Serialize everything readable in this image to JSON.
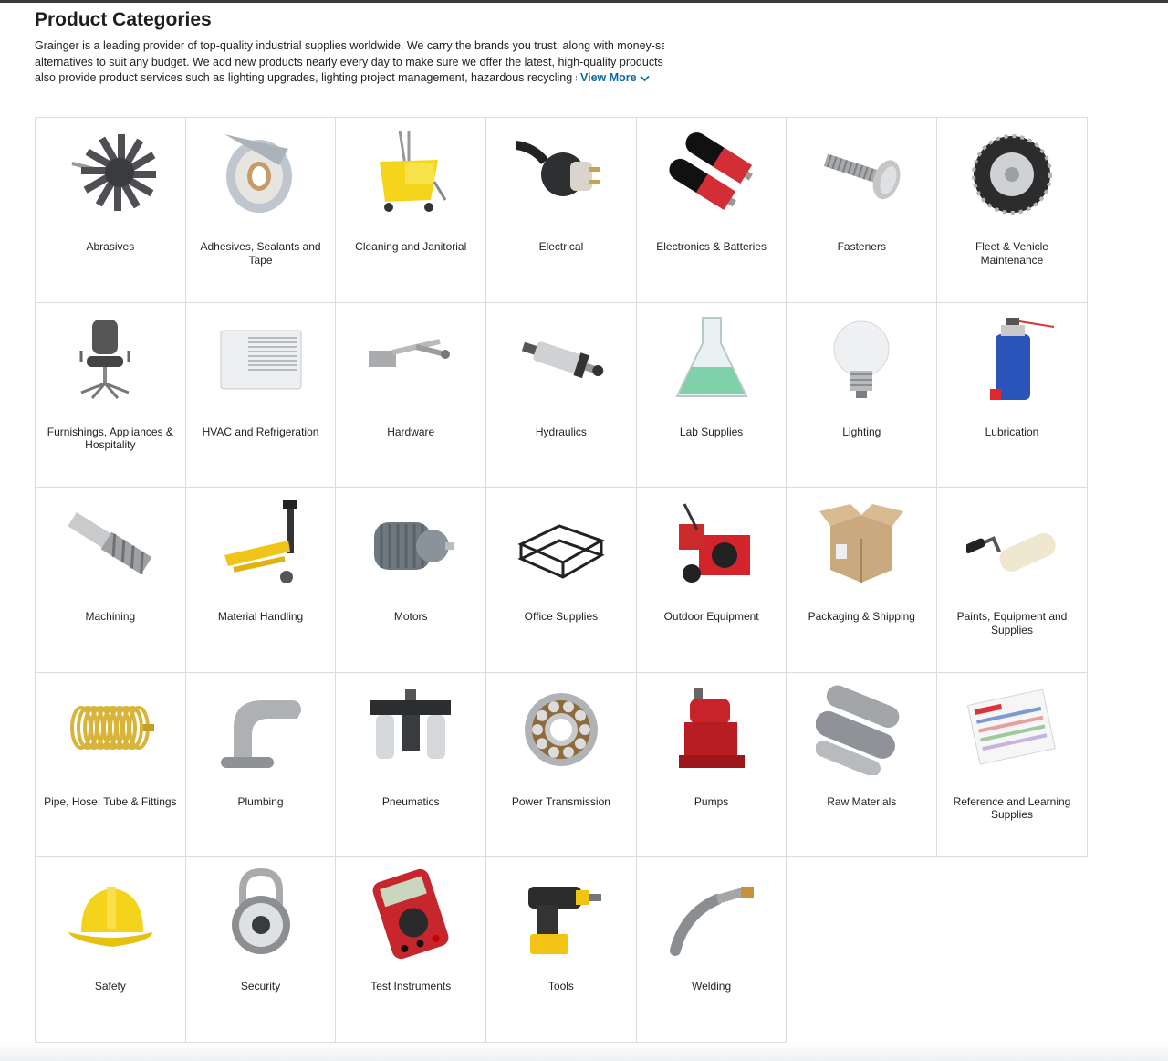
{
  "page": {
    "title": "Product Categories",
    "intro_lines": [
      "Grainger is a leading provider of top-quality industrial supplies worldwide. We carry the brands you trust, along with money-saving",
      "alternatives to suit any budget. We add new products nearly every day to make sure we offer the latest, high-quality products. We",
      "also provide product services such as lighting upgrades, lighting project management, hazardous recycling service"
    ],
    "view_more_label": "View More",
    "accent_color": "#0b6aa2"
  },
  "categories": [
    {
      "label": "Abrasives",
      "icon": "flap-wheel-icon"
    },
    {
      "label": "Adhesives, Sealants and Tape",
      "icon": "tape-roll-icon"
    },
    {
      "label": "Cleaning and Janitorial",
      "icon": "mop-bucket-icon"
    },
    {
      "label": "Electrical",
      "icon": "plug-icon"
    },
    {
      "label": "Electronics & Batteries",
      "icon": "battery-icon"
    },
    {
      "label": "Fasteners",
      "icon": "screw-icon"
    },
    {
      "label": "Fleet & Vehicle Maintenance",
      "icon": "tire-chain-icon"
    },
    {
      "label": "Furnishings, Appliances & Hospitality",
      "icon": "office-chair-icon"
    },
    {
      "label": "HVAC and Refrigeration",
      "icon": "air-conditioner-icon"
    },
    {
      "label": "Hardware",
      "icon": "door-closer-icon"
    },
    {
      "label": "Hydraulics",
      "icon": "hydraulic-cylinder-icon"
    },
    {
      "label": "Lab Supplies",
      "icon": "flask-icon"
    },
    {
      "label": "Lighting",
      "icon": "light-bulb-icon"
    },
    {
      "label": "Lubrication",
      "icon": "spray-can-icon"
    },
    {
      "label": "Machining",
      "icon": "end-mill-icon"
    },
    {
      "label": "Material Handling",
      "icon": "pallet-jack-icon"
    },
    {
      "label": "Motors",
      "icon": "electric-motor-icon"
    },
    {
      "label": "Office Supplies",
      "icon": "desk-tray-icon"
    },
    {
      "label": "Outdoor Equipment",
      "icon": "snow-blower-icon"
    },
    {
      "label": "Packaging & Shipping",
      "icon": "cardboard-box-icon"
    },
    {
      "label": "Paints, Equipment and Supplies",
      "icon": "paint-roller-icon"
    },
    {
      "label": "Pipe, Hose, Tube & Fittings",
      "icon": "coiled-hose-icon"
    },
    {
      "label": "Plumbing",
      "icon": "faucet-icon"
    },
    {
      "label": "Pneumatics",
      "icon": "air-filter-regulator-icon"
    },
    {
      "label": "Power Transmission",
      "icon": "bearing-icon"
    },
    {
      "label": "Pumps",
      "icon": "sump-pump-icon"
    },
    {
      "label": "Raw Materials",
      "icon": "metal-rods-icon"
    },
    {
      "label": "Reference and Learning Supplies",
      "icon": "reference-chart-icon"
    },
    {
      "label": "Safety",
      "icon": "hard-hat-icon"
    },
    {
      "label": "Security",
      "icon": "combination-lock-icon"
    },
    {
      "label": "Test Instruments",
      "icon": "multimeter-icon"
    },
    {
      "label": "Tools",
      "icon": "cordless-drill-icon"
    },
    {
      "label": "Welding",
      "icon": "mig-gun-icon"
    }
  ]
}
